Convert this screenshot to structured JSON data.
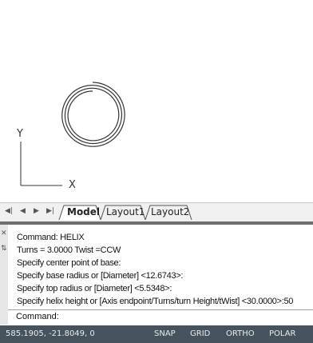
{
  "canvas": {
    "ucs": {
      "y_label": "Y",
      "x_label": "X"
    }
  },
  "tabs": {
    "nav_icons": [
      "first-tab-icon",
      "prev-tab-icon",
      "next-tab-icon",
      "last-tab-icon"
    ],
    "items": [
      {
        "label": "Model",
        "active": true
      },
      {
        "label": "Layout1",
        "active": false
      },
      {
        "label": "Layout2",
        "active": false
      }
    ]
  },
  "command": {
    "history": [
      "Command: HELIX",
      "Turns = 3.0000 Twist =CCW",
      "Specify center point of base:",
      "Specify base radius or [Diameter] <12.6743>:",
      "Specify top radius or [Diameter] <5.5348>:",
      "Specify helix height or [Axis endpoint/Turns/turn Height/tWist] <30.0000>:50"
    ],
    "prompt": "Command:"
  },
  "status": {
    "coordinates": "585.1905, -21.8049, 0",
    "toggles": [
      "SNAP",
      "GRID",
      "ORTHO",
      "POLAR"
    ]
  },
  "colors": {
    "statusbar_bg": "#46525e",
    "tabbar_bg": "#f0f0f0",
    "drawing_line": "#333333"
  }
}
